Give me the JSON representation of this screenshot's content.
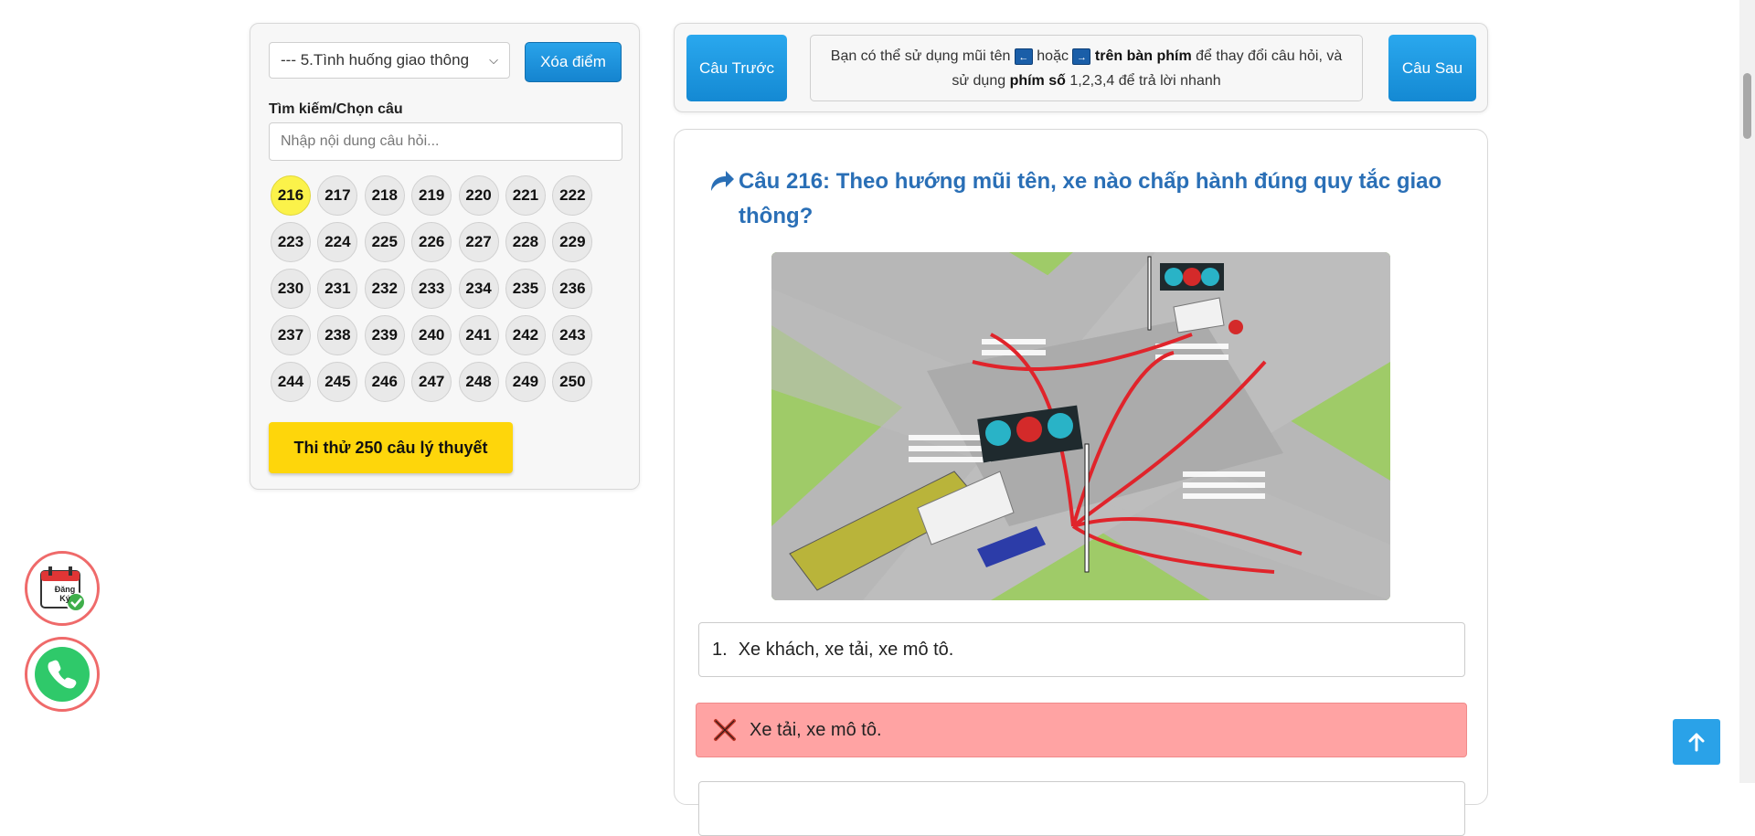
{
  "sidebar": {
    "category_select": "--- 5.Tình huống giao thông",
    "clear_button": "Xóa điểm",
    "search_label": "Tìm kiếm/Chọn câu",
    "search_placeholder": "Nhập nội dung câu hỏi...",
    "question_numbers": [
      "216",
      "217",
      "218",
      "219",
      "220",
      "221",
      "222",
      "223",
      "224",
      "225",
      "226",
      "227",
      "228",
      "229",
      "230",
      "231",
      "232",
      "233",
      "234",
      "235",
      "236",
      "237",
      "238",
      "239",
      "240",
      "241",
      "242",
      "243",
      "244",
      "245",
      "246",
      "247",
      "248",
      "249",
      "250"
    ],
    "active_question": "216",
    "exam_button": "Thi thử 250 câu lý thuyết"
  },
  "nav": {
    "prev_button": "Câu Trước",
    "next_button": "Câu Sau",
    "hint_part1": "Bạn có thể sử dụng mũi tên",
    "hint_or": "hoặc",
    "hint_keyboard": "trên bàn phím",
    "hint_part2": "để thay đổi câu hỏi, và",
    "hint_part3": "sử dụng",
    "hint_numkeys": "phím số",
    "hint_part4": "1,2,3,4 để trả lời nhanh",
    "key_left": "←",
    "key_right": "→"
  },
  "question": {
    "title": "Câu 216: Theo hướng mũi tên, xe nào chấp hành đúng quy tắc giao thông?",
    "answers": [
      {
        "index": "1.",
        "text": "Xe khách, xe tải, xe mô tô.",
        "state": "normal"
      },
      {
        "index": "",
        "text": "Xe tải, xe mô tô.",
        "state": "wrong"
      }
    ]
  },
  "floating": {
    "register_label_line1": "Đăng",
    "register_label_line2": "Ký"
  },
  "colors": {
    "accent_blue": "#1e8fd8",
    "title_blue": "#2a6fb6",
    "exam_yellow": "#fed60b",
    "active_yellow": "#fbf24a",
    "wrong_red": "#ffa3a3",
    "call_green": "#2fc96a"
  }
}
